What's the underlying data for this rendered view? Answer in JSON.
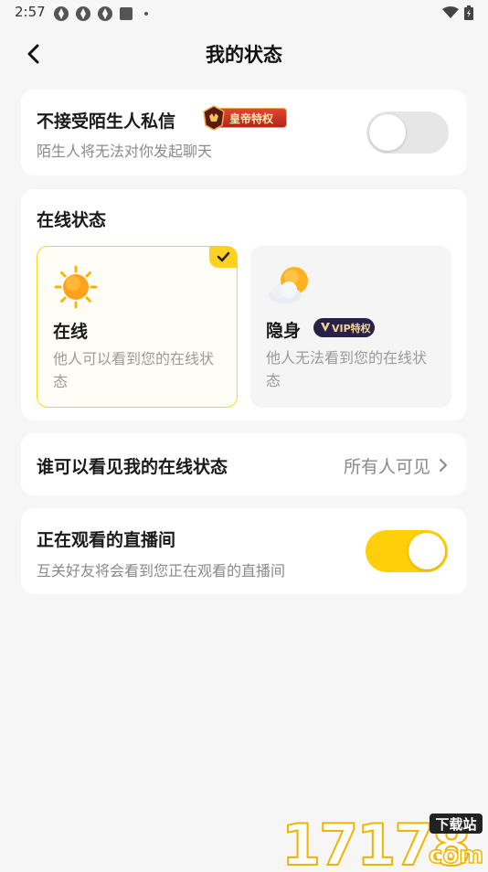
{
  "status_bar": {
    "time": "2:57"
  },
  "header": {
    "title": "我的状态"
  },
  "stranger_messages": {
    "title": "不接受陌生人私信",
    "badge": "皇帝特权",
    "subtitle": "陌生人将无法对你发起聊天",
    "enabled": false
  },
  "online_status": {
    "title": "在线状态",
    "options": [
      {
        "name": "在线",
        "desc": "他人可以看到您的在线状态",
        "selected": true,
        "icon": "sun-icon"
      },
      {
        "name": "隐身",
        "desc": "他人无法看到您的在线状态",
        "selected": false,
        "icon": "cloud-sun-icon",
        "badge": "VIP特权"
      }
    ]
  },
  "visibility": {
    "label": "谁可以看见我的在线状态",
    "value": "所有人可见"
  },
  "watching_live": {
    "title": "正在观看的直播间",
    "subtitle": "互关好友将会看到您正在观看的直播间",
    "enabled": true
  },
  "watermark": {
    "digits": "17178",
    "tag": "下载站",
    "suffix": "com"
  },
  "colors": {
    "accent": "#ffcf0a",
    "card": "#ffffff",
    "background": "#f6f6f6"
  }
}
